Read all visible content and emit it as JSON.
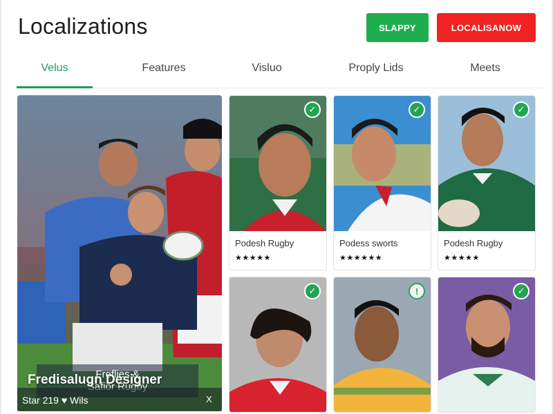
{
  "header": {
    "title": "Localizations",
    "btn_primary": "SLAPPY",
    "btn_danger": "LOCALISANOW"
  },
  "tabs": [
    {
      "label": "Velus",
      "active": true
    },
    {
      "label": "Features",
      "active": false
    },
    {
      "label": "Visluo",
      "active": false
    },
    {
      "label": "Proply Lids",
      "active": false
    },
    {
      "label": "Meets",
      "active": false
    }
  ],
  "feature": {
    "caption": "Froflies &\nSafior Rugby",
    "title": "Fredisalugn Designer",
    "meta": "Star 219 ♥ Wils",
    "close": "X"
  },
  "cards": [
    {
      "name": "Podesh Rugby",
      "stars": "★★★★★",
      "check": "✓",
      "jersey": "#c8202c",
      "bg": "#2f6f44"
    },
    {
      "name": "Podess sworts",
      "stars": "★★★★★★",
      "check": "✓",
      "jersey": "#f4f4f4",
      "bg": "#3b8fd0"
    },
    {
      "name": "Podesh Rugby",
      "stars": "★★★★★",
      "check": "✓",
      "jersey": "#1f6b43",
      "bg": "#9bbfd9"
    },
    {
      "name": "",
      "stars": "",
      "check": "✓",
      "jersey": "#d8232f",
      "bg": "#b8b8b8"
    },
    {
      "name": "",
      "stars": "",
      "check": "!",
      "jersey": "#f2b43a",
      "bg": "#9aa8b4"
    },
    {
      "name": "",
      "stars": "",
      "check": "✓",
      "jersey": "#e6f2ee",
      "bg": "#7a5ca5"
    }
  ],
  "colors": {
    "accent_green": "#1f9a58",
    "button_green": "#1fae4f",
    "button_red": "#f02222"
  }
}
